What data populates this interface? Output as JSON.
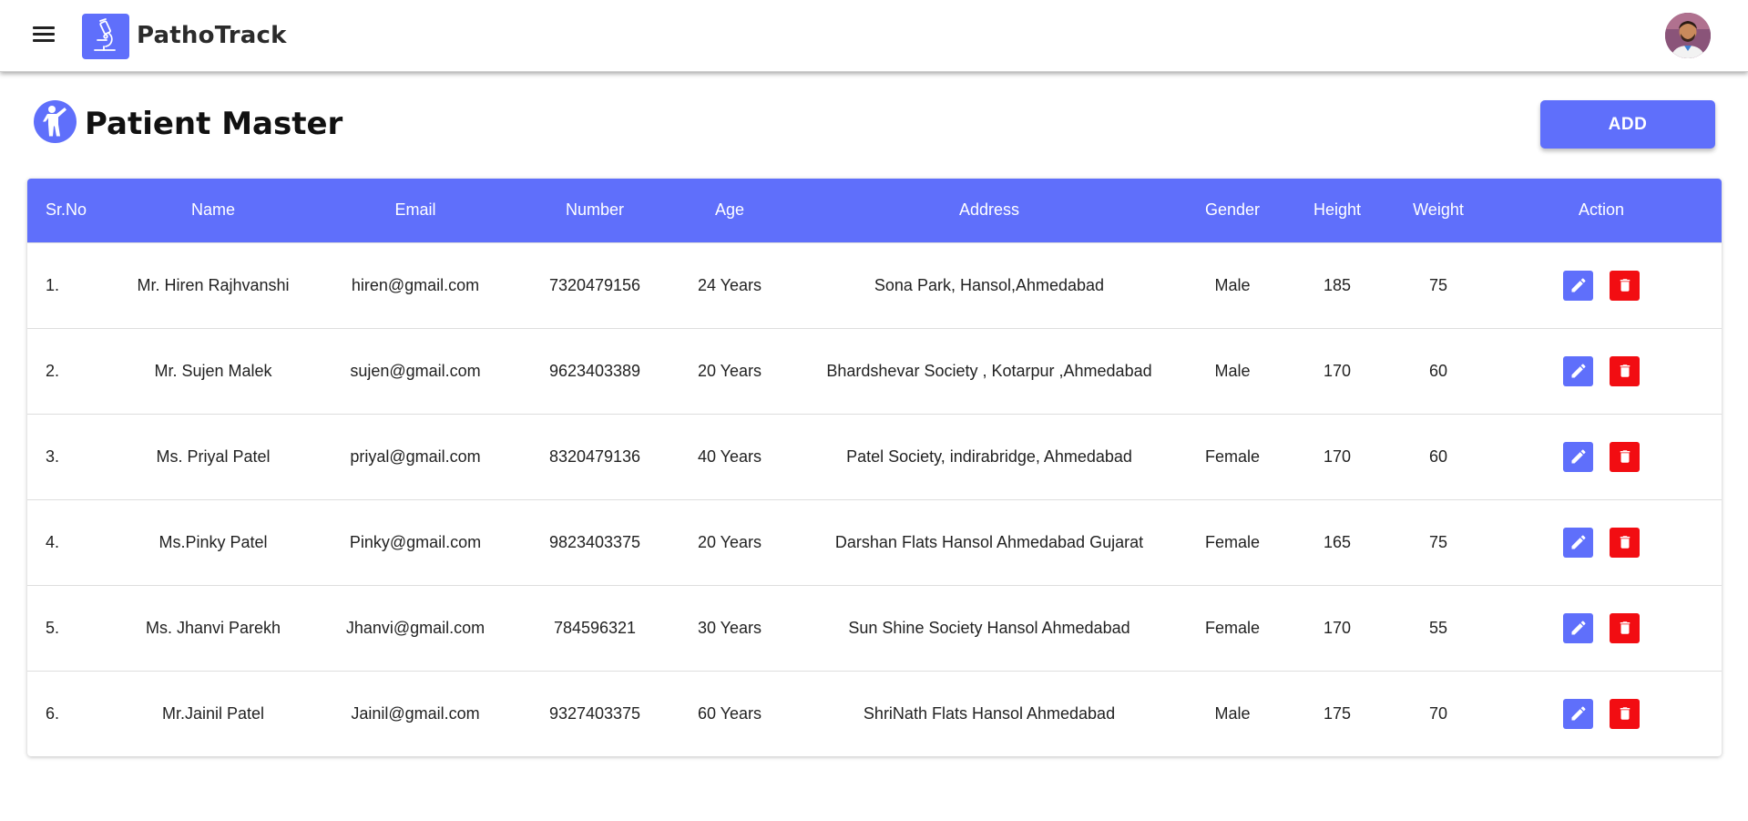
{
  "app": {
    "brand": "PathoTrack"
  },
  "page": {
    "title": "Patient Master",
    "add_label": "ADD"
  },
  "colors": {
    "primary": "#5f6ffb",
    "danger": "#f20d12"
  },
  "table": {
    "headers": {
      "srno": "Sr.No",
      "name": "Name",
      "email": "Email",
      "number": "Number",
      "age": "Age",
      "address": "Address",
      "gender": "Gender",
      "height": "Height",
      "weight": "Weight",
      "action": "Action"
    },
    "rows": [
      {
        "srno": "1.",
        "name": "Mr. Hiren Rajhvanshi",
        "email": "hiren@gmail.com",
        "number": "7320479156",
        "age": "24 Years",
        "address": "Sona Park, Hansol,Ahmedabad",
        "gender": "Male",
        "height": "185",
        "weight": "75"
      },
      {
        "srno": "2.",
        "name": "Mr. Sujen Malek",
        "email": "sujen@gmail.com",
        "number": "9623403389",
        "age": "20 Years",
        "address": "Bhardshevar Society , Kotarpur ,Ahmedabad",
        "gender": "Male",
        "height": "170",
        "weight": "60"
      },
      {
        "srno": "3.",
        "name": "Ms. Priyal Patel",
        "email": "priyal@gmail.com",
        "number": "8320479136",
        "age": "40 Years",
        "address": "Patel Society, indirabridge, Ahmedabad",
        "gender": "Female",
        "height": "170",
        "weight": "60"
      },
      {
        "srno": "4.",
        "name": "Ms.Pinky Patel",
        "email": "Pinky@gmail.com",
        "number": "9823403375",
        "age": "20 Years",
        "address": "Darshan Flats Hansol Ahmedabad Gujarat",
        "gender": "Female",
        "height": "165",
        "weight": "75"
      },
      {
        "srno": "5.",
        "name": "Ms. Jhanvi Parekh",
        "email": "Jhanvi@gmail.com",
        "number": "784596321",
        "age": "30 Years",
        "address": "Sun Shine Society Hansol Ahmedabad",
        "gender": "Female",
        "height": "170",
        "weight": "55"
      },
      {
        "srno": "6.",
        "name": "Mr.Jainil Patel",
        "email": "Jainil@gmail.com",
        "number": "9327403375",
        "age": "60 Years",
        "address": "ShriNath Flats Hansol Ahmedabad",
        "gender": "Male",
        "height": "175",
        "weight": "70"
      }
    ]
  }
}
